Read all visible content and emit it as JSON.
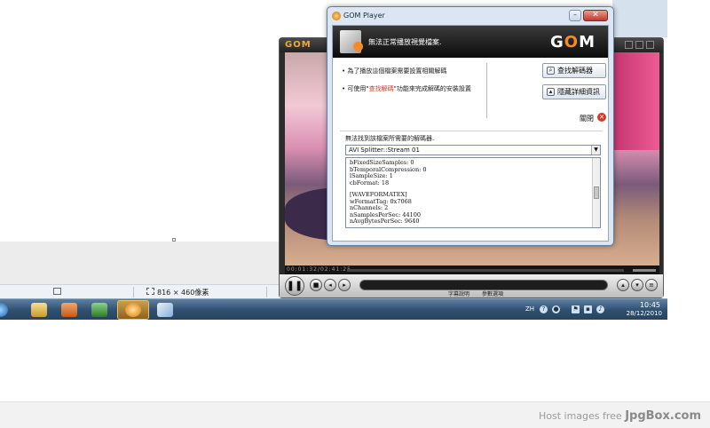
{
  "statusbar": {
    "image_size": "816 × 460像素"
  },
  "taskbar": {
    "lang": "ZH",
    "time": "10:45",
    "date": "28/12/2010"
  },
  "gom": {
    "time": "00:01:32/02:41:25",
    "subtitle_label": "字幕說明",
    "settings_label": "參數選項"
  },
  "dialog": {
    "title": "GOM Player",
    "header_text": "無法正常播放視覺檔案.",
    "logo": "GOM",
    "bullet1": "為了播放這個檔案需要設置相關解碼",
    "bullet2_pre": "可使用\"",
    "bullet2_hl": "查找解碼",
    "bullet2_post": "\"功能來完成解碼的安裝設置",
    "find_codec_button": "查找解碼器",
    "hide_details_button": "隱藏詳細資訊",
    "close_label": "關閉",
    "error_label": "無法找到該檔案所需要的解碼器.",
    "combo_value": "AVI Splitter::Stream 01",
    "info_lines_a": [
      "bFixedSizeSamples: 0",
      "bTemporalCompression: 0",
      "lSampleSize: 1",
      "cbFormat: 18"
    ],
    "info_lines_b": [
      "[WAVEFORMATEX]",
      "wFormatTag: 0x7068",
      "nChannels: 2",
      "nSamplesPerSec: 44100",
      "nAvgBytesPerSec: 9640"
    ]
  },
  "banner": {
    "prefix": "Host images free ",
    "brand": "JpgBox.com"
  }
}
